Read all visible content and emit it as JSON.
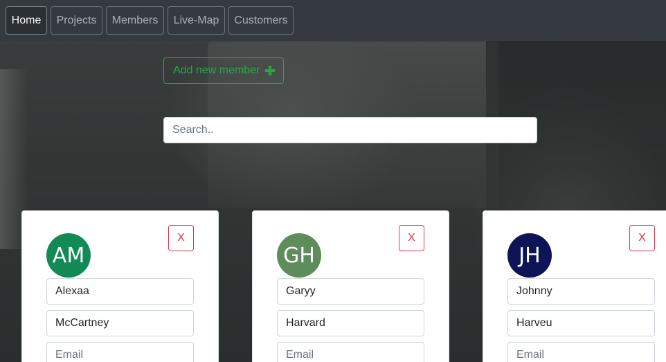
{
  "nav": {
    "items": [
      {
        "label": "Home",
        "active": true
      },
      {
        "label": "Projects",
        "active": false
      },
      {
        "label": "Members",
        "active": false
      },
      {
        "label": "Live-Map",
        "active": false
      },
      {
        "label": "Customers",
        "active": false
      }
    ]
  },
  "actions": {
    "add_member_label": "Add new member",
    "add_icon": "plus-icon"
  },
  "search": {
    "placeholder": "Search.."
  },
  "members": [
    {
      "initials": "AM",
      "first_name": "Alexaa",
      "last_name": "McCartney",
      "email_placeholder": "Email",
      "avatar_color": "#128a57",
      "close_label": "X"
    },
    {
      "initials": "GH",
      "first_name": "Garyy",
      "last_name": "Harvard",
      "email_placeholder": "Email",
      "avatar_color": "#5e8c5a",
      "close_label": "X"
    },
    {
      "initials": "JH",
      "first_name": "Johnny",
      "last_name": "Harveu",
      "email_placeholder": "Email",
      "avatar_color": "#0e1557",
      "close_label": "X"
    }
  ],
  "colors": {
    "navbar": "#343a40",
    "success": "#28a745",
    "danger": "#dc3545"
  }
}
